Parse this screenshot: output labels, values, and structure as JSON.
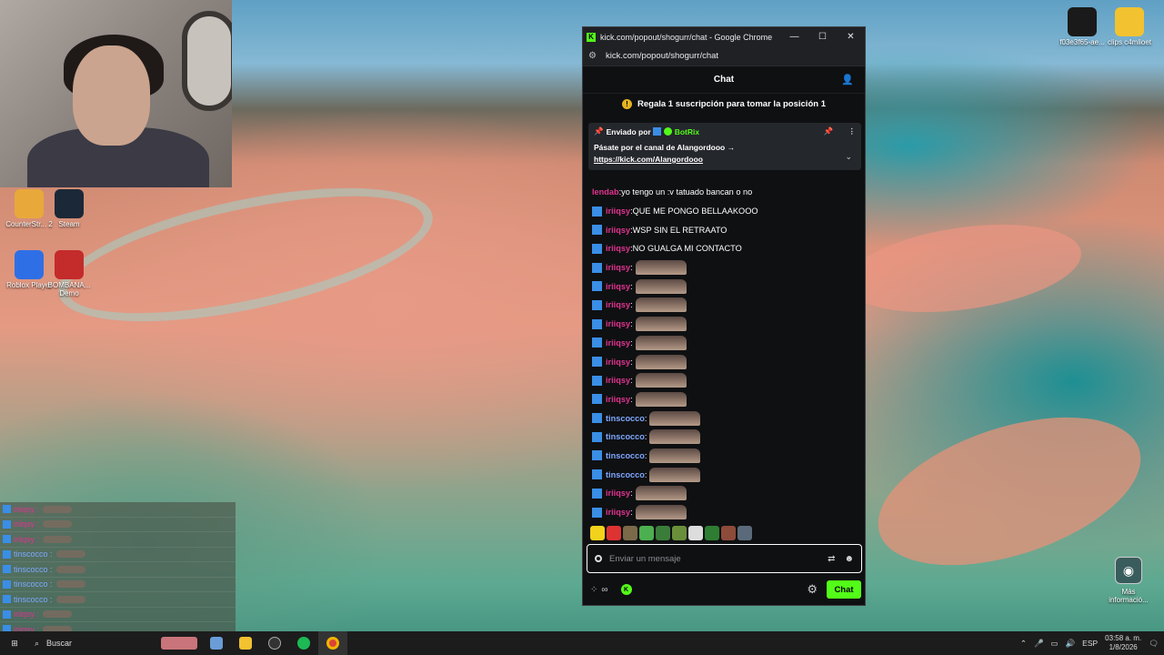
{
  "desktop": {
    "icons_left": [
      {
        "label": "CounterStr... 2",
        "icon": "counter-strike-icon",
        "color": "#e8a93a"
      },
      {
        "label": "Steam",
        "icon": "steam-icon",
        "color": "#1b2838"
      },
      {
        "label": "Roblox Player",
        "icon": "roblox-icon",
        "color": "#2f6fe6"
      },
      {
        "label": "BOMBANA... Demo",
        "icon": "bombana-icon",
        "color": "#c42b2b"
      }
    ],
    "icons_right": [
      {
        "label": "f03e3f65-ae...",
        "icon": "image-file-icon"
      },
      {
        "label": "clips c4mlioet",
        "icon": "folder-icon"
      }
    ],
    "info_label": "Más informació..."
  },
  "overlay_chat": [
    {
      "name": "iriiqsy",
      "color": "#e0338f"
    },
    {
      "name": "iriiqsy",
      "color": "#e0338f"
    },
    {
      "name": "iriiqsy",
      "color": "#e0338f"
    },
    {
      "name": "tinscocco",
      "color": "#7ea7ff"
    },
    {
      "name": "tinscocco",
      "color": "#7ea7ff"
    },
    {
      "name": "tinscocco",
      "color": "#7ea7ff"
    },
    {
      "name": "tinscocco",
      "color": "#7ea7ff"
    },
    {
      "name": "iriiqsy",
      "color": "#e0338f"
    },
    {
      "name": "iriiqsy",
      "color": "#e0338f"
    }
  ],
  "browser": {
    "window_title": "kick.com/popout/shogurr/chat - Google Chrome",
    "url": "kick.com/popout/shogurr/chat",
    "minimize": "—",
    "maximize": "☐",
    "close": "✕"
  },
  "chat": {
    "header": "Chat",
    "promo": "Regala 1 suscripción para tomar la posición 1",
    "pinned": {
      "sent_by": "Enviado por",
      "bot_name": "BotRix",
      "message": "Pásate por el canal de Alangordooo →",
      "link": "https://kick.com/Alangordooo"
    },
    "messages": [
      {
        "name": "lendab",
        "color": "#e0338f",
        "verified": false,
        "text": "yo tengo un :v tatuado bancan o no",
        "emote": false
      },
      {
        "name": "iriiqsy",
        "color": "#e0338f",
        "verified": true,
        "text": "QUE ME PONGO BELLAAKOOO",
        "emote": false
      },
      {
        "name": "iriiqsy",
        "color": "#e0338f",
        "verified": true,
        "text": "WSP SIN EL RETRAATO",
        "emote": false
      },
      {
        "name": "iriiqsy",
        "color": "#e0338f",
        "verified": true,
        "text": "NO GUALGA MI CONTACTO",
        "emote": false
      },
      {
        "name": "iriiqsy",
        "color": "#e0338f",
        "verified": true,
        "text": "",
        "emote": true
      },
      {
        "name": "iriiqsy",
        "color": "#e0338f",
        "verified": true,
        "text": "",
        "emote": true
      },
      {
        "name": "iriiqsy",
        "color": "#e0338f",
        "verified": true,
        "text": "",
        "emote": true
      },
      {
        "name": "iriiqsy",
        "color": "#e0338f",
        "verified": true,
        "text": "",
        "emote": true
      },
      {
        "name": "iriiqsy",
        "color": "#e0338f",
        "verified": true,
        "text": "",
        "emote": true
      },
      {
        "name": "iriiqsy",
        "color": "#e0338f",
        "verified": true,
        "text": "",
        "emote": true
      },
      {
        "name": "iriiqsy",
        "color": "#e0338f",
        "verified": true,
        "text": "",
        "emote": true
      },
      {
        "name": "iriiqsy",
        "color": "#e0338f",
        "verified": true,
        "text": "",
        "emote": true
      },
      {
        "name": "tinscocco",
        "color": "#7ea7ff",
        "verified": true,
        "text": "",
        "emote": true
      },
      {
        "name": "tinscocco",
        "color": "#7ea7ff",
        "verified": true,
        "text": "",
        "emote": true
      },
      {
        "name": "tinscocco",
        "color": "#7ea7ff",
        "verified": true,
        "text": "",
        "emote": true
      },
      {
        "name": "tinscocco",
        "color": "#7ea7ff",
        "verified": true,
        "text": "",
        "emote": true
      },
      {
        "name": "iriiqsy",
        "color": "#e0338f",
        "verified": true,
        "text": "",
        "emote": true
      },
      {
        "name": "iriiqsy",
        "color": "#e0338f",
        "verified": true,
        "text": "",
        "emote": true
      }
    ],
    "emote_bar_colors": [
      "#f2d21b",
      "#d33",
      "#7a6a4a",
      "#4caf50",
      "#3a7d3a",
      "#6a8f3a",
      "#ddd",
      "#2e7d32",
      "#8d4b3a",
      "#5a6a7a"
    ],
    "input_placeholder": "Enviar un mensaje",
    "send_label": "Chat",
    "infinity_glyph": "∞",
    "k_badge": "K"
  },
  "taskbar": {
    "search_label": "Buscar",
    "language": "ESP",
    "time": "03:58 a. m.",
    "date": "1/8/2026",
    "apps": [
      "windows-start-icon",
      "shark-app-icon",
      "calculator-icon",
      "file-explorer-icon",
      "obs-icon",
      "spotify-icon",
      "chrome-icon"
    ]
  },
  "colors": {
    "kick_green": "#53fc18",
    "name_pink": "#e0338f",
    "name_blue": "#7ea7ff",
    "kick_badge": "#3a8ee6"
  }
}
